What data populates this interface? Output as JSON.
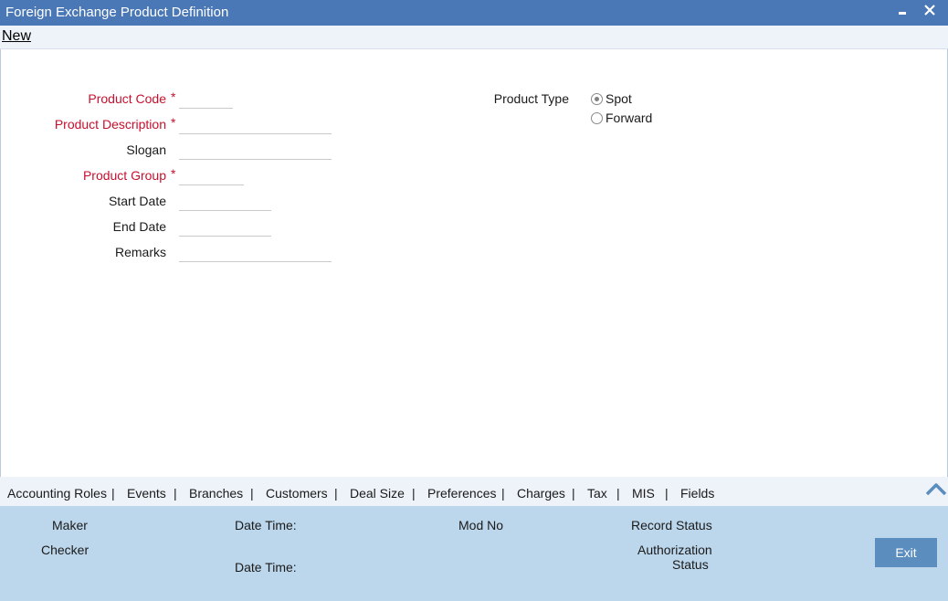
{
  "window": {
    "title": "Foreign Exchange Product Definition",
    "minimize_glyph": "▬",
    "close_glyph": "✕"
  },
  "toolbar": {
    "new_label": "New"
  },
  "form": {
    "product_code_label": "Product Code",
    "product_description_label": "Product Description",
    "slogan_label": "Slogan",
    "product_group_label": "Product Group",
    "start_date_label": "Start Date",
    "end_date_label": "End Date",
    "remarks_label": "Remarks",
    "required_marker": "*",
    "product_code": "",
    "product_description": "",
    "slogan": "",
    "product_group": "",
    "start_date": "",
    "end_date": "",
    "remarks": ""
  },
  "product_type": {
    "label": "Product Type",
    "options": [
      "Spot",
      "Forward"
    ],
    "selected": "Spot"
  },
  "tabs": {
    "items": [
      "Accounting Roles",
      "Events",
      "Branches",
      "Customers",
      "Deal Size",
      "Preferences",
      "Charges",
      "Tax",
      "MIS",
      "Fields"
    ],
    "separator": "|",
    "collapse_icon": "chevron-up-icon"
  },
  "footer": {
    "maker_label": "Maker",
    "checker_label": "Checker",
    "maker_date_time_label": "Date Time:",
    "checker_date_time_label": "Date Time:",
    "mod_no_label": "Mod No",
    "record_status_label": "Record Status",
    "authorization_label": "Authorization",
    "status_label": "Status",
    "exit_label": "Exit"
  },
  "colors": {
    "title_bar": "#4a77b5",
    "required": "#c8102e",
    "footer_bg": "#bcd7ec",
    "exit_button": "#5b8ebf"
  }
}
